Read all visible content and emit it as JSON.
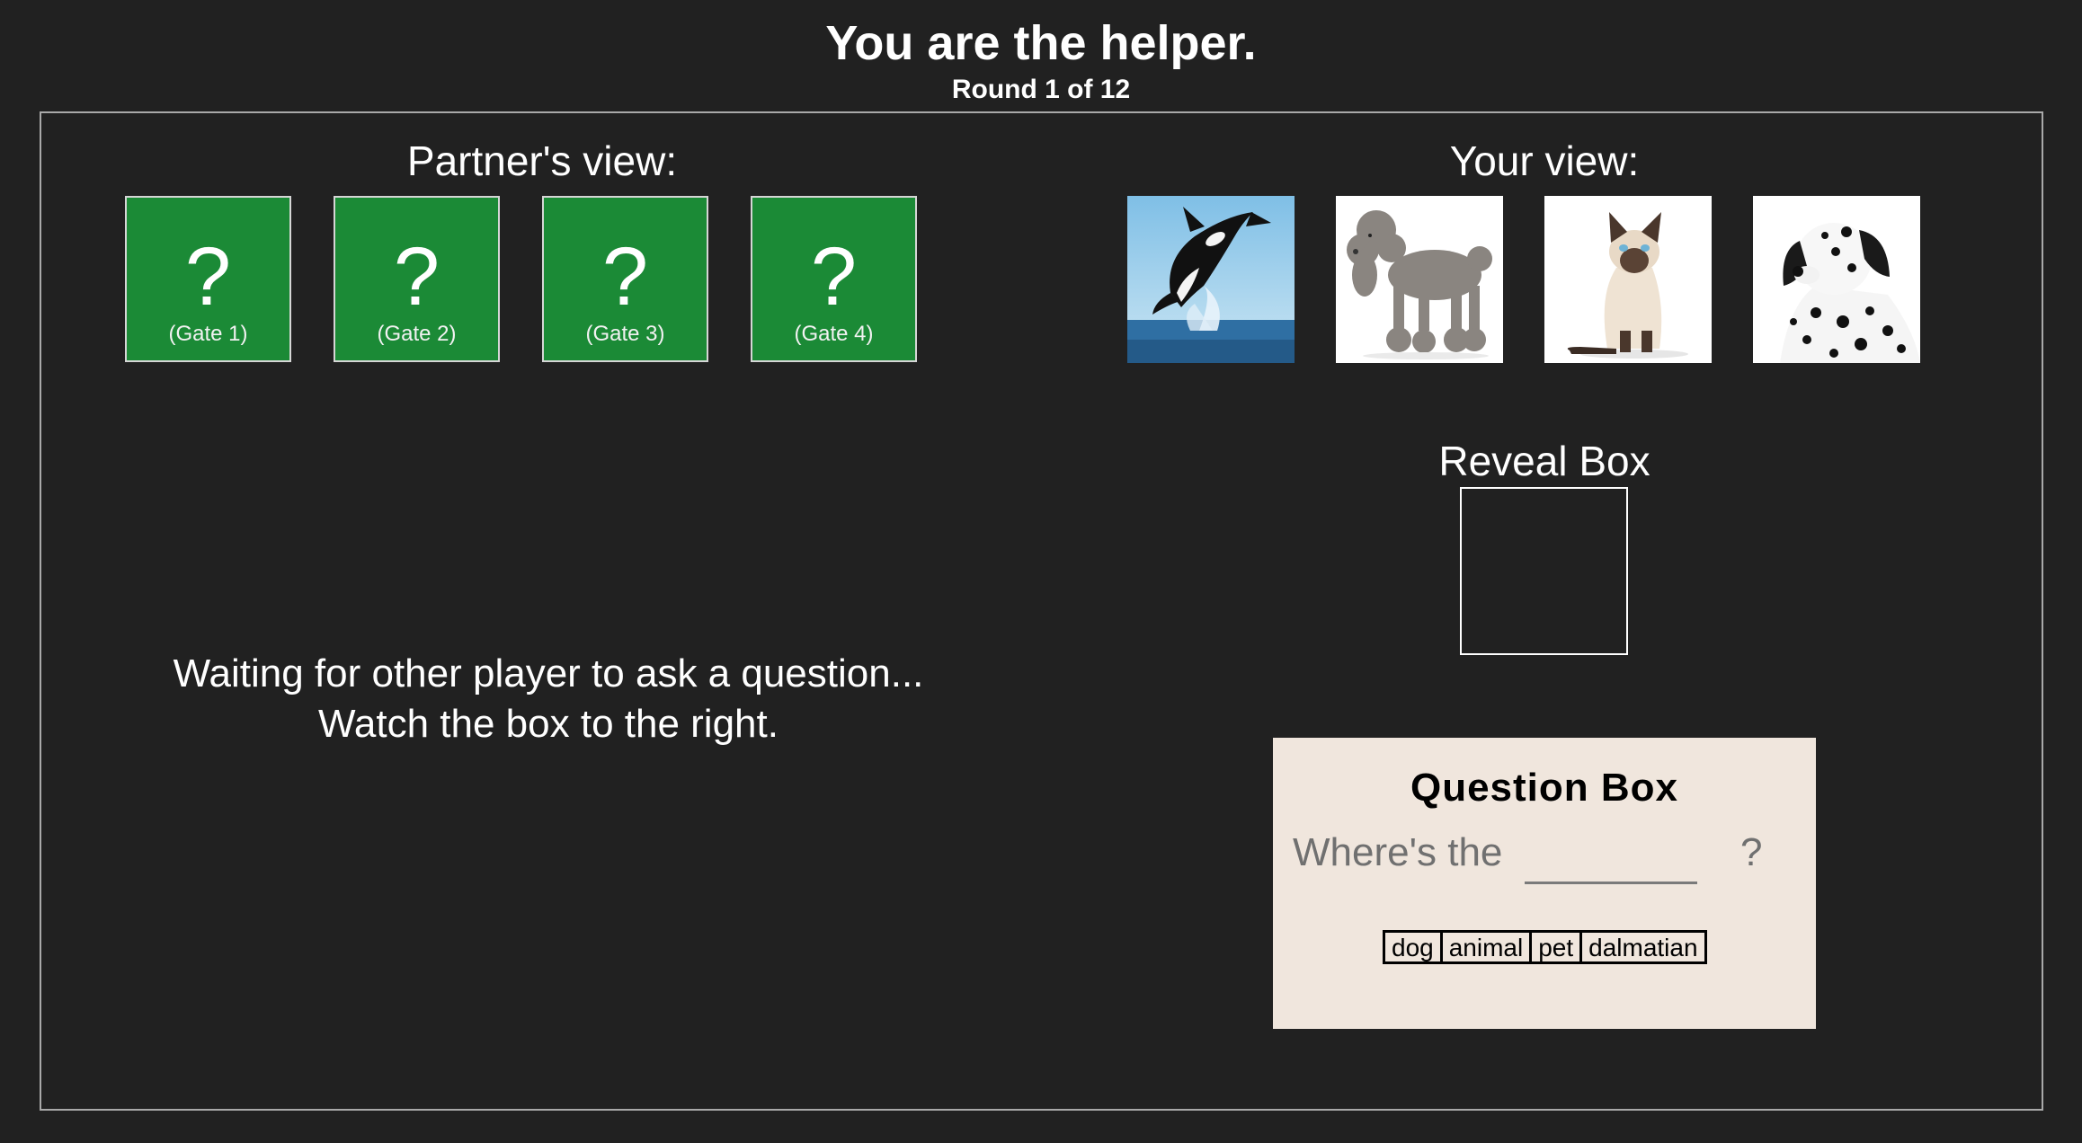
{
  "header": {
    "title": "You are the helper.",
    "round": "Round 1 of 12"
  },
  "partner_view": {
    "heading": "Partner's view:",
    "gates": [
      {
        "symbol": "?",
        "label": "(Gate 1)",
        "color": "#1b8a36"
      },
      {
        "symbol": "?",
        "label": "(Gate 2)",
        "color": "#1b8a36"
      },
      {
        "symbol": "?",
        "label": "(Gate 3)",
        "color": "#1b8a36"
      },
      {
        "symbol": "?",
        "label": "(Gate 4)",
        "color": "#1b8a36"
      }
    ]
  },
  "your_view": {
    "heading": "Your view:",
    "images": [
      {
        "icon": "orca-image"
      },
      {
        "icon": "poodle-image"
      },
      {
        "icon": "siamese-cat-image"
      },
      {
        "icon": "dalmatian-image"
      }
    ]
  },
  "reveal_box": {
    "heading": "Reveal Box"
  },
  "status": {
    "line1": "Waiting for other player to ask a question...",
    "line2": "Watch the box to the right."
  },
  "question_box": {
    "title": "Question Box",
    "prompt": "Where's the",
    "question_mark": "?",
    "words": [
      "dog",
      "animal",
      "pet",
      "dalmatian"
    ],
    "background": "#f0e6dd"
  }
}
